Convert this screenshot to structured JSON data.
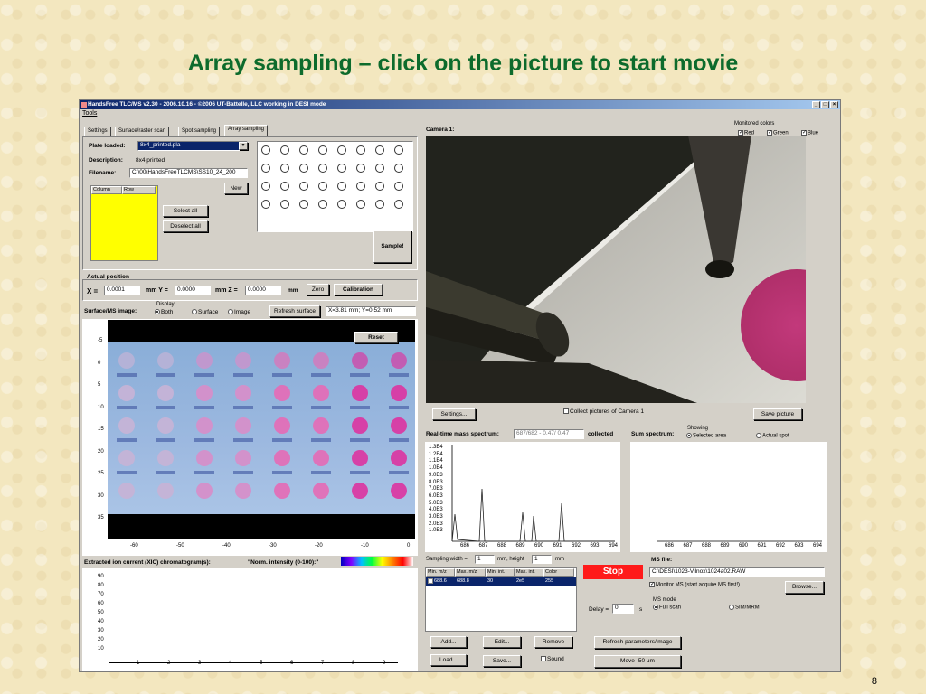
{
  "slide": {
    "title": "Array sampling – click on the picture to start movie",
    "page_number": "8"
  },
  "window": {
    "title": "HandsFree TLC/MS v2.30 - 2006.10.16 - ©2006 UT-Battelle, LLC working in DESI mode",
    "min": "_",
    "max": "□",
    "close": "×"
  },
  "menu": {
    "tools": "Tools"
  },
  "tabs": [
    "Settings",
    "Surface/raster scan",
    "Spot sampling",
    "Array sampling"
  ],
  "plate": {
    "loaded_label": "Plate loaded:",
    "loaded_value": "8x4_printed.pla",
    "description_label": "Description:",
    "description_value": "8x4 printed",
    "filename_label": "Filename:",
    "filename_value": "C:\\00\\HandsFreeTLCMS\\SS10_24_200",
    "new_button": "New",
    "column_header": "Column",
    "row_header": "Row",
    "select_all": "Select all",
    "deselect_all": "Deselect all",
    "sample_button": "Sample!"
  },
  "position": {
    "title": "Actual position",
    "x_label": "X =",
    "x_value": "0.0001",
    "y_label": "mm  Y =",
    "y_value": "0.0000",
    "z_label": "mm  Z =",
    "z_value": "0.0000",
    "unit": "mm",
    "zero": "Zero",
    "calibration": "Calibration"
  },
  "surface": {
    "label": "Surface/MS image:",
    "display_label": "Display",
    "opt_both": "Both",
    "opt_surface": "Surface",
    "opt_image": "Image",
    "refresh": "Refresh surface",
    "coord_readout": "X=3.81 mm; Y=0.52 mm",
    "reset": "Reset",
    "y_ticks": [
      "-5",
      "0",
      "5",
      "10",
      "15",
      "20",
      "25",
      "30",
      "35"
    ],
    "x_ticks": [
      "-60",
      "-50",
      "-40",
      "-30",
      "-20",
      "-10",
      "0"
    ],
    "spot_colors": [
      "#c5b3d6",
      "#d58fc9",
      "#e26fb7",
      "#d93aa3"
    ]
  },
  "xic": {
    "label": "Extracted ion current (XIC) chromatogram(s):",
    "intensity_label": "\"Norm. intensity (0-100):\"",
    "y_ticks": [
      "90",
      "80",
      "70",
      "60",
      "50",
      "40",
      "30",
      "20",
      "10"
    ],
    "x_ticks": [
      "1",
      "2",
      "3",
      "4",
      "5",
      "6",
      "7",
      "8",
      "9"
    ]
  },
  "camera": {
    "label": "Camera 1:",
    "monitored_colors": "Monitored colors",
    "red": "Red",
    "green": "Green",
    "blue": "Blue",
    "settings": "Settings...",
    "collect": "Collect pictures of Camera 1",
    "save_picture": "Save picture"
  },
  "realtime": {
    "label": "Real-time mass spectrum:",
    "range_value": "687/682 - 0.47/ 0.47",
    "collected": "collected",
    "y_ticks": [
      "1.3E4",
      "1.2E4",
      "1.1E4",
      "1.0E4",
      "9.0E3",
      "8.0E3",
      "7.0E3",
      "6.0E3",
      "5.0E3",
      "4.0E3",
      "3.0E3",
      "2.0E3",
      "1.0E3"
    ],
    "x_ticks": [
      "686",
      "687",
      "688",
      "689",
      "690",
      "691",
      "692",
      "693",
      "694"
    ]
  },
  "sum": {
    "label": "Sum spectrum:",
    "showing": "Showing",
    "opt_selected": "Selected area",
    "opt_actual": "Actual spot",
    "x_ticks": [
      "686",
      "687",
      "688",
      "689",
      "690",
      "691",
      "692",
      "693",
      "694"
    ]
  },
  "sampling": {
    "width_label": "Sampling width =",
    "width_value": "1",
    "height_label": "mm, height",
    "height_value": "1",
    "unit": "mm",
    "table_headers": [
      "Min. m/z",
      "Max. m/z",
      "Min. int.",
      "Max. int.",
      "Color"
    ],
    "row": [
      "688.6",
      "688.8",
      "30",
      "2e5",
      "255"
    ],
    "add": "Add...",
    "edit": "Edit...",
    "remove": "Remove",
    "load": "Load...",
    "save": "Save...",
    "sound": "Sound"
  },
  "ms": {
    "stop": "Stop",
    "file_label": "MS file:",
    "file_value": "C:\\DESI\\1023-Vilnox\\1024a02.RAW",
    "monitor": "Monitor MS (start acquire MS first!)",
    "browse": "Browse...",
    "delay_label": "Delay =",
    "delay_value": "0",
    "delay_unit": "s",
    "mode_label": "MS mode",
    "full_scan": "Full scan",
    "sim": "SIM/MRM",
    "refresh_params": "Refresh parameters/image",
    "move": "Move -50 um"
  }
}
